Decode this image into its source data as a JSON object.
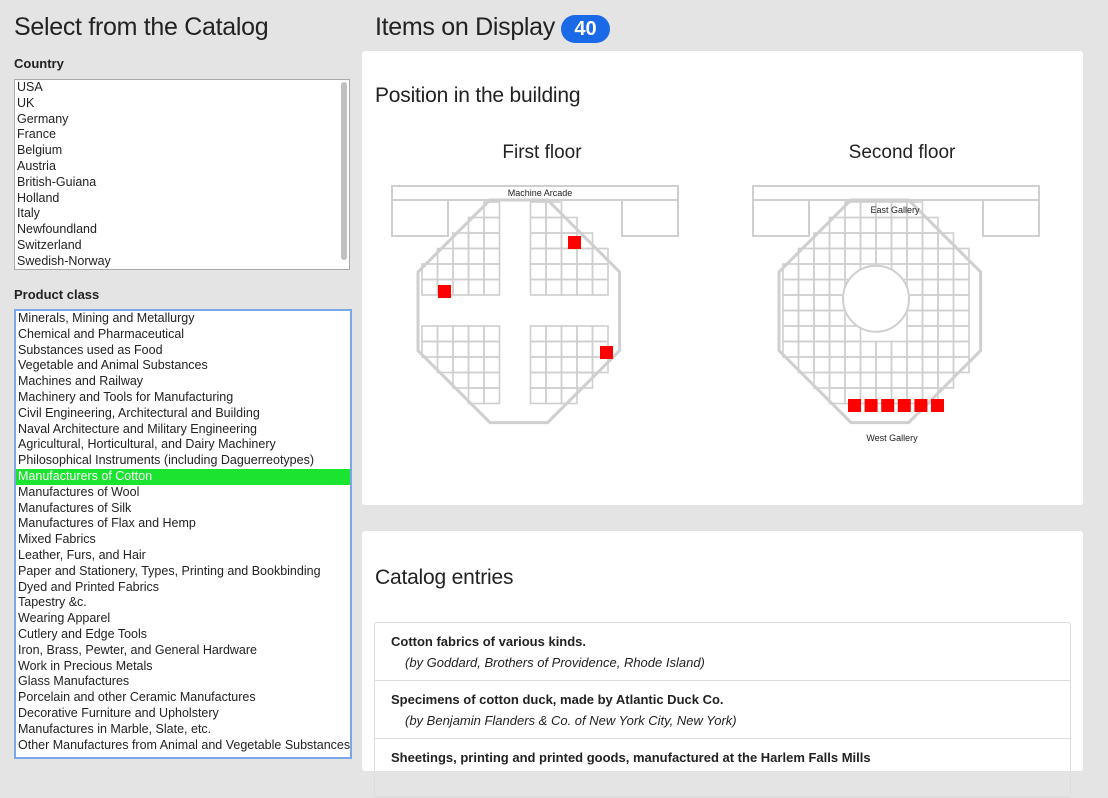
{
  "sidebar": {
    "title": "Select from the Catalog",
    "country_label": "Country",
    "countries": [
      "USA",
      "UK",
      "Germany",
      "France",
      "Belgium",
      "Austria",
      "British-Guiana",
      "Holland",
      "Italy",
      "Newfoundland",
      "Switzerland",
      "Swedish-Norway"
    ],
    "product_label": "Product class",
    "products": [
      "Minerals, Mining and Metallurgy",
      "Chemical and Pharmaceutical",
      "Substances used as Food",
      "Vegetable and Animal Substances",
      "Machines and Railway",
      "Machinery and Tools for Manufacturing",
      "Civil Engineering, Architectural and Building",
      "Naval Architecture and Military Engineering",
      "Agricultural, Horticultural, and Dairy Machinery",
      "Philosophical Instruments (including Daguerreotypes)",
      "Manufacturers of Cotton",
      "Manufactures of Wool",
      "Manufactures of Silk",
      "Manufactures of Flax and Hemp",
      "Mixed Fabrics",
      "Leather, Furs, and Hair",
      "Paper and Stationery, Types, Printing and Bookbinding",
      "Dyed and Printed Fabrics",
      "Tapestry &c.",
      "Wearing Apparel",
      "Cutlery and Edge Tools",
      "Iron, Brass, Pewter, and General Hardware",
      "Work in Precious Metals",
      "Glass Manufactures",
      "Porcelain and other Ceramic Manufactures",
      "Decorative Furniture and Upholstery",
      "Manufactures in Marble, Slate, etc.",
      "Other Manufactures from Animal and Vegetable Substances"
    ],
    "selected_product": "Manufacturers of Cotton"
  },
  "main": {
    "title": "Items on Display",
    "count": "40",
    "position_title": "Position in the building",
    "first_floor": {
      "title": "First floor",
      "label": "Machine Arcade"
    },
    "second_floor": {
      "title": "Second floor",
      "label_top": "East Gallery",
      "label_bottom": "West Gallery"
    },
    "highlight_color": "#ff0000",
    "catalog_title": "Catalog entries",
    "entries": [
      {
        "title": "Cotton fabrics of various kinds.",
        "source": "(by Goddard, Brothers of Providence, Rhode Island)"
      },
      {
        "title": "Specimens of cotton duck, made by Atlantic Duck Co.",
        "source": "(by Benjamin Flanders & Co. of New York City, New York)"
      },
      {
        "title": "Sheetings, printing and printed goods, manufactured at the Harlem Falls Mills",
        "source": ""
      }
    ]
  }
}
